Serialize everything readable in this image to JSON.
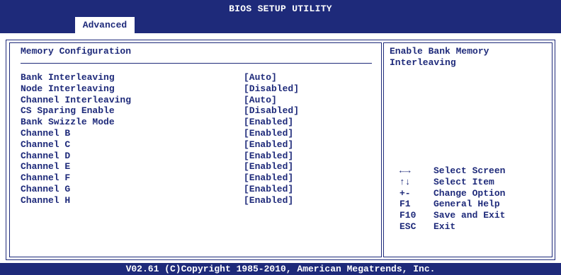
{
  "header": {
    "title": "BIOS SETUP UTILITY",
    "active_tab": "Advanced"
  },
  "main": {
    "section_title": "Memory Configuration",
    "settings": [
      {
        "label": "Bank Interleaving",
        "value": "[Auto]"
      },
      {
        "label": "Node Interleaving",
        "value": "[Disabled]"
      },
      {
        "label": "Channel Interleaving",
        "value": "[Auto]"
      },
      {
        "label": "CS Sparing Enable",
        "value": "[Disabled]"
      },
      {
        "label": "Bank Swizzle Mode",
        "value": "[Enabled]"
      },
      {
        "label": "Channel B",
        "value": "[Enabled]"
      },
      {
        "label": "Channel C",
        "value": "[Enabled]"
      },
      {
        "label": "Channel D",
        "value": "[Enabled]"
      },
      {
        "label": "Channel E",
        "value": "[Enabled]"
      },
      {
        "label": "Channel F",
        "value": "[Enabled]"
      },
      {
        "label": "Channel G",
        "value": "[Enabled]"
      },
      {
        "label": "Channel H",
        "value": "[Enabled]"
      }
    ]
  },
  "help": {
    "line1": "Enable Bank Memory",
    "line2": "Interleaving"
  },
  "keys": [
    {
      "key": "←→",
      "action": "Select Screen"
    },
    {
      "key": "↑↓",
      "action": "Select Item"
    },
    {
      "key": "+-",
      "action": "Change Option"
    },
    {
      "key": "F1",
      "action": "General Help"
    },
    {
      "key": "F10",
      "action": "Save and Exit"
    },
    {
      "key": "ESC",
      "action": "Exit"
    }
  ],
  "footer": {
    "copyright": "V02.61 (C)Copyright 1985-2010, American Megatrends, Inc."
  },
  "colors": {
    "primary": "#1e2a7a",
    "background": "#ffffff"
  }
}
